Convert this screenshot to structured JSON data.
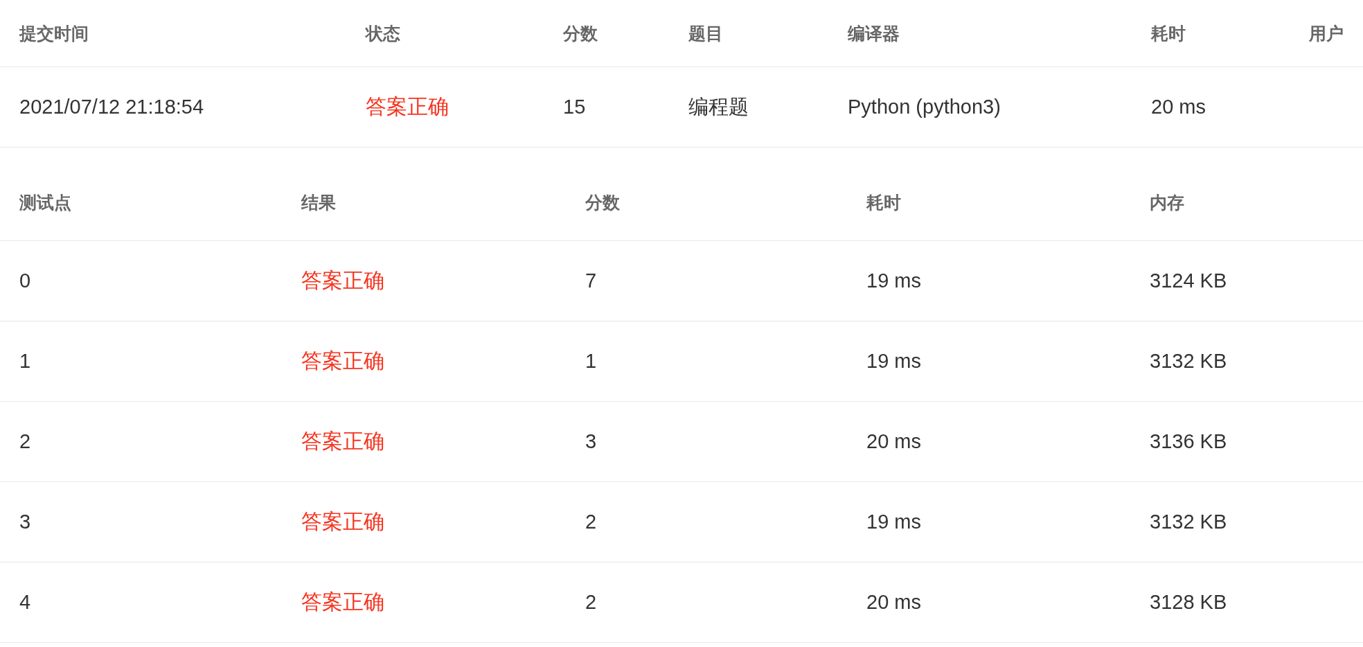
{
  "submission": {
    "columns": [
      {
        "label": "提交时间",
        "kind": "text"
      },
      {
        "label": "状态",
        "kind": "status"
      },
      {
        "label": "分数",
        "kind": "text"
      },
      {
        "label": "题目",
        "kind": "text"
      },
      {
        "label": "编译器",
        "kind": "text"
      },
      {
        "label": "耗时",
        "kind": "text"
      },
      {
        "label": "用户",
        "kind": "text"
      }
    ],
    "rows": [
      [
        "2021/07/12 21:18:54",
        "答案正确",
        "15",
        "编程题",
        "Python (python3)",
        "20 ms"
      ]
    ]
  },
  "test_cases": {
    "columns": [
      {
        "label": "测试点",
        "kind": "text"
      },
      {
        "label": "结果",
        "kind": "status"
      },
      {
        "label": "分数",
        "kind": "text"
      },
      {
        "label": "耗时",
        "kind": "text"
      },
      {
        "label": "内存",
        "kind": "text"
      }
    ],
    "rows": [
      [
        "0",
        "答案正确",
        "7",
        "19 ms",
        "3124 KB"
      ],
      [
        "1",
        "答案正确",
        "1",
        "19 ms",
        "3132 KB"
      ],
      [
        "2",
        "答案正确",
        "3",
        "20 ms",
        "3136 KB"
      ],
      [
        "3",
        "答案正确",
        "2",
        "19 ms",
        "3132 KB"
      ],
      [
        "4",
        "答案正确",
        "2",
        "20 ms",
        "3128 KB"
      ]
    ]
  }
}
